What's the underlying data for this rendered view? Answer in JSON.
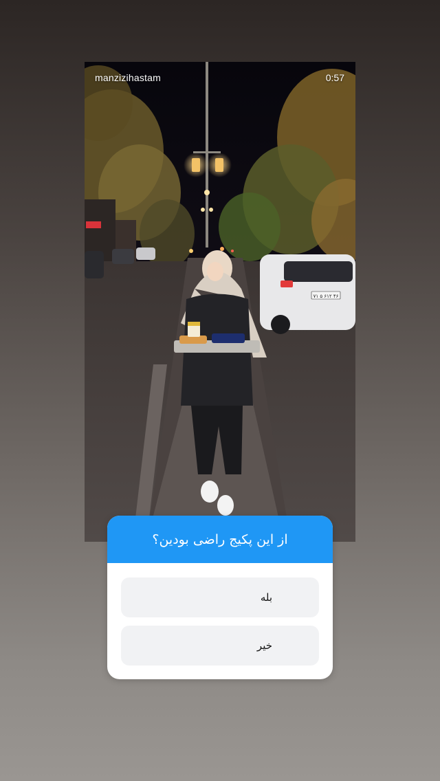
{
  "story": {
    "username": "manzizihastam",
    "time_remaining": "0:57",
    "plate_text": "۷۱ ۵ ۶۱۲ ۴۶"
  },
  "poll": {
    "question": "از این پکیج راضی بودین؟",
    "options": [
      {
        "label": "بله"
      },
      {
        "label": "خیر"
      }
    ]
  },
  "colors": {
    "poll_header": "#1f97f5",
    "option_bg": "#f1f2f4"
  }
}
